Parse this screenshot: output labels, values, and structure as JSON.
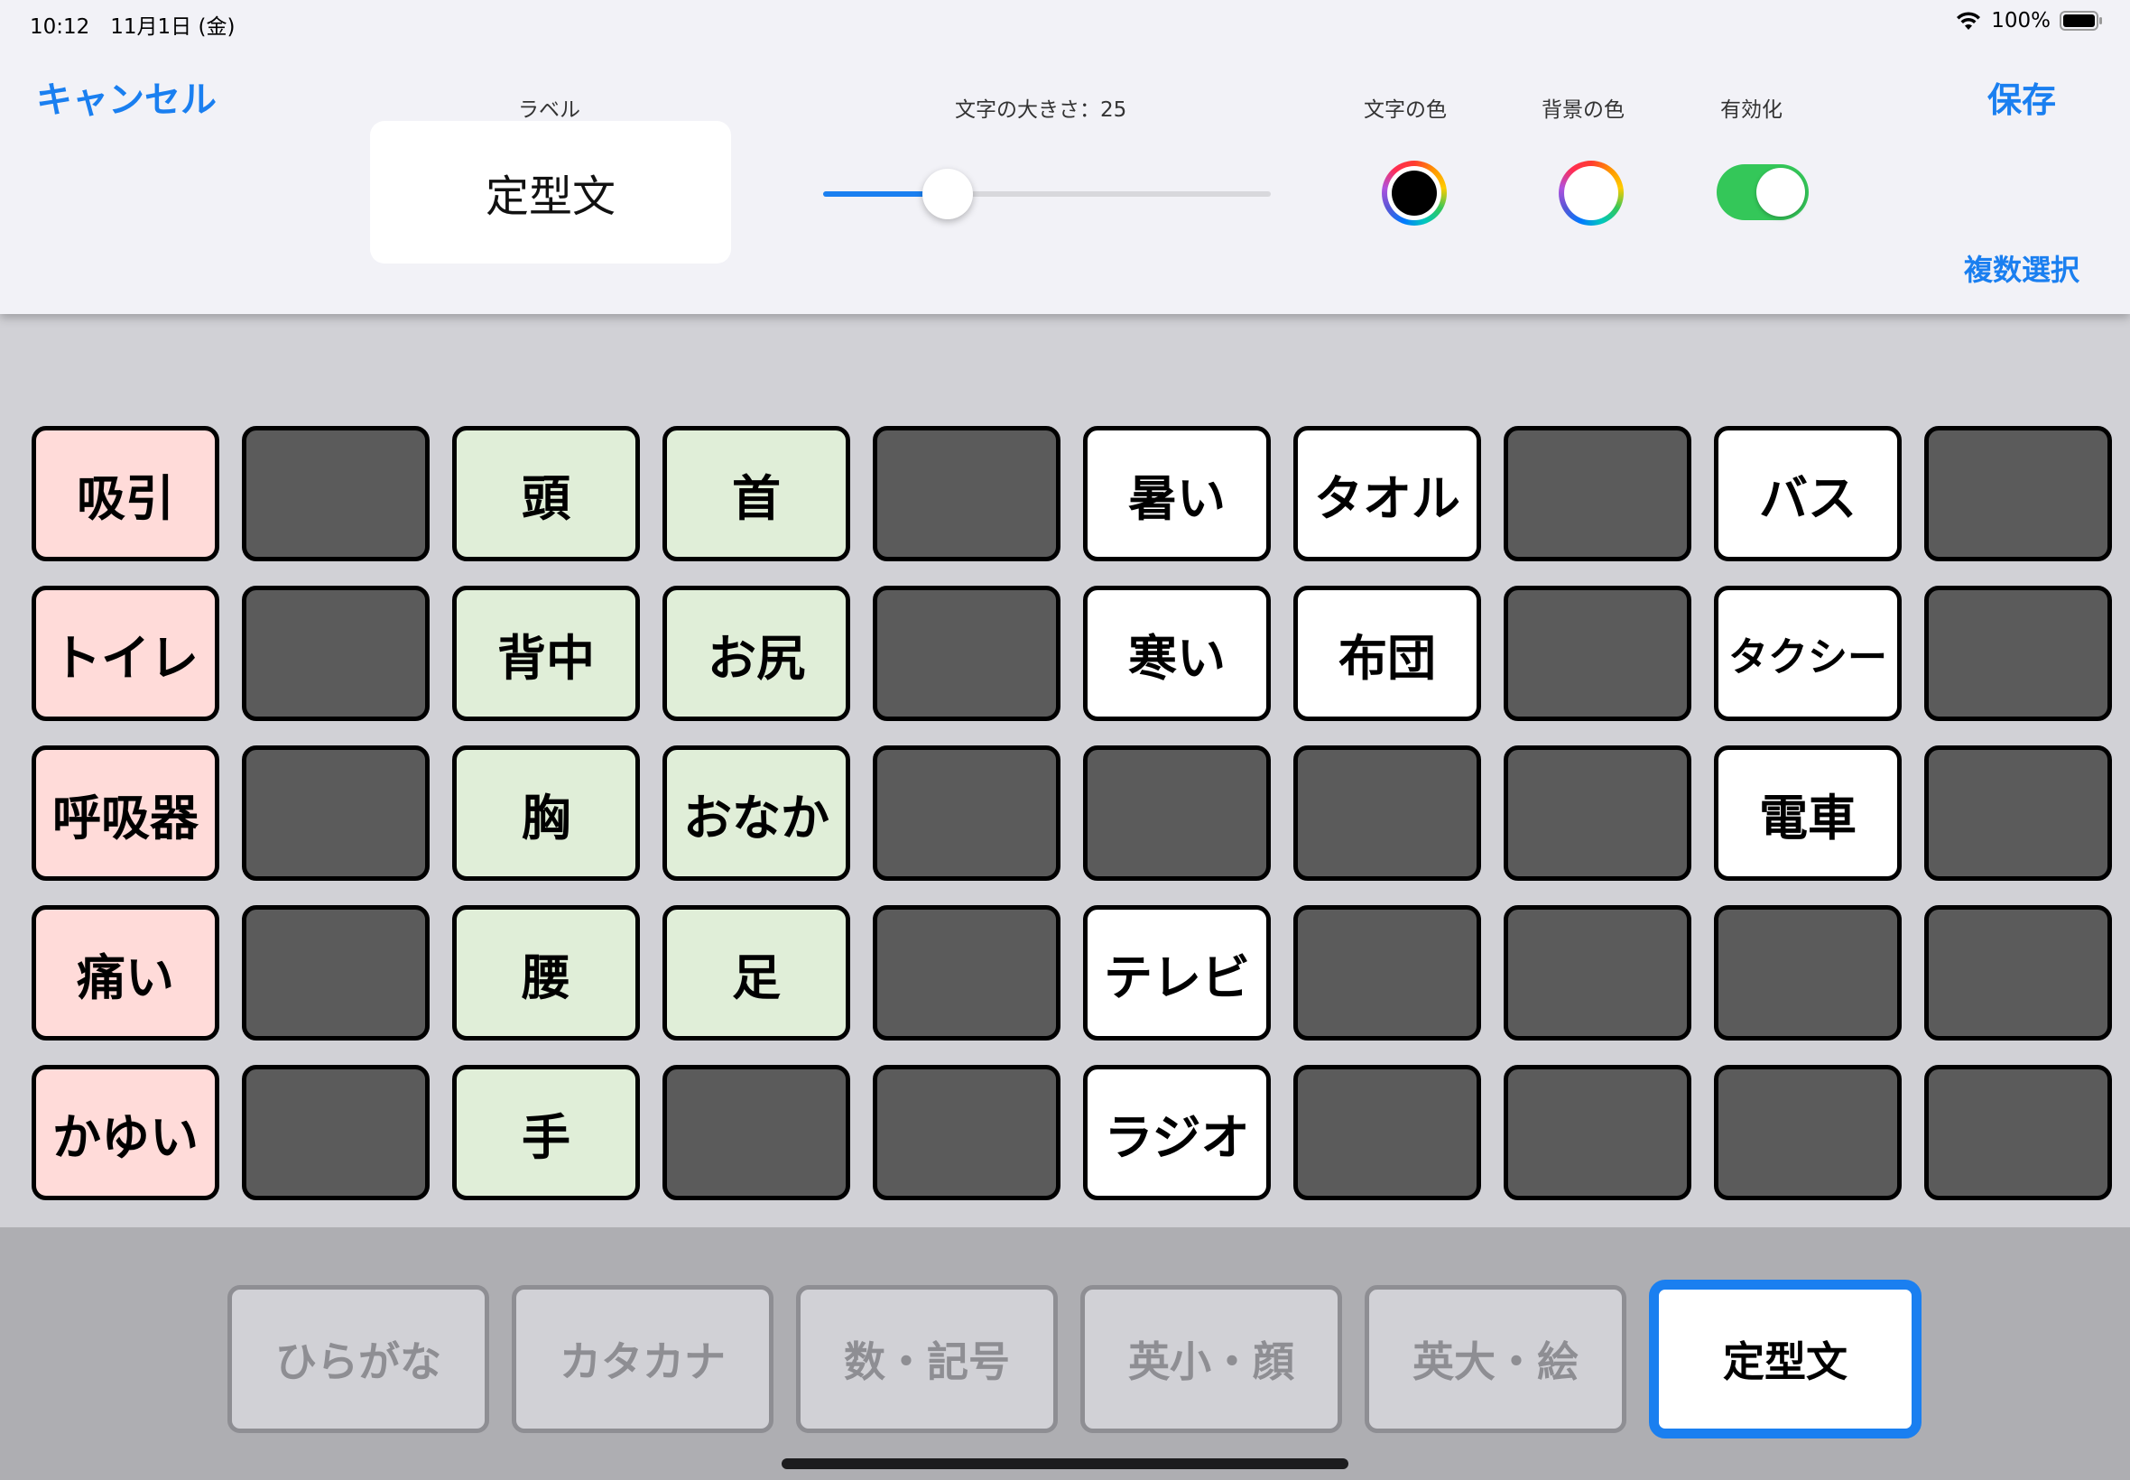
{
  "status_bar": {
    "time": "10:12　11月1日 (金)",
    "battery": "100%",
    "icons": [
      "wifi-icon",
      "battery-icon"
    ]
  },
  "toolbar": {
    "cancel_label": "キャンセル",
    "save_label": "保存",
    "multi_select_label": "複数選択",
    "label_caption": "ラベル",
    "label_value": "定型文",
    "font_size_caption": "文字の大きさ：25",
    "font_size_value": 25,
    "text_color_caption": "文字の色",
    "text_color": "#000000",
    "bg_color_caption": "背景の色",
    "bg_color": "#ffffff",
    "enabled_caption": "有効化",
    "enabled": true
  },
  "colors": {
    "accent": "#1a7ff0",
    "toggle_on": "#34c759",
    "pink": "#ffdbd9",
    "green": "#e0eed8",
    "white": "#ffffff",
    "empty": "#5b5b5b"
  },
  "grid": {
    "rows": [
      [
        {
          "label": "吸引",
          "color": "pink"
        },
        {
          "label": "",
          "color": "empty"
        },
        {
          "label": "頭",
          "color": "green"
        },
        {
          "label": "首",
          "color": "green"
        },
        {
          "label": "",
          "color": "empty"
        },
        {
          "label": "暑い",
          "color": "white"
        },
        {
          "label": "タオル",
          "color": "white"
        },
        {
          "label": "",
          "color": "empty"
        },
        {
          "label": "バス",
          "color": "white"
        },
        {
          "label": "",
          "color": "empty"
        }
      ],
      [
        {
          "label": "トイレ",
          "color": "pink"
        },
        {
          "label": "",
          "color": "empty"
        },
        {
          "label": "背中",
          "color": "green"
        },
        {
          "label": "お尻",
          "color": "green"
        },
        {
          "label": "",
          "color": "empty"
        },
        {
          "label": "寒い",
          "color": "white"
        },
        {
          "label": "布団",
          "color": "white"
        },
        {
          "label": "",
          "color": "empty"
        },
        {
          "label": "タクシー",
          "color": "white"
        },
        {
          "label": "",
          "color": "empty"
        }
      ],
      [
        {
          "label": "呼吸器",
          "color": "pink"
        },
        {
          "label": "",
          "color": "empty"
        },
        {
          "label": "胸",
          "color": "green"
        },
        {
          "label": "おなか",
          "color": "green"
        },
        {
          "label": "",
          "color": "empty"
        },
        {
          "label": "",
          "color": "empty"
        },
        {
          "label": "",
          "color": "empty"
        },
        {
          "label": "",
          "color": "empty"
        },
        {
          "label": "電車",
          "color": "white"
        },
        {
          "label": "",
          "color": "empty"
        }
      ],
      [
        {
          "label": "痛い",
          "color": "pink"
        },
        {
          "label": "",
          "color": "empty"
        },
        {
          "label": "腰",
          "color": "green"
        },
        {
          "label": "足",
          "color": "green"
        },
        {
          "label": "",
          "color": "empty"
        },
        {
          "label": "テレビ",
          "color": "white"
        },
        {
          "label": "",
          "color": "empty"
        },
        {
          "label": "",
          "color": "empty"
        },
        {
          "label": "",
          "color": "empty"
        },
        {
          "label": "",
          "color": "empty"
        }
      ],
      [
        {
          "label": "かゆい",
          "color": "pink"
        },
        {
          "label": "",
          "color": "empty"
        },
        {
          "label": "手",
          "color": "green"
        },
        {
          "label": "",
          "color": "empty"
        },
        {
          "label": "",
          "color": "empty"
        },
        {
          "label": "ラジオ",
          "color": "white"
        },
        {
          "label": "",
          "color": "empty"
        },
        {
          "label": "",
          "color": "empty"
        },
        {
          "label": "",
          "color": "empty"
        },
        {
          "label": "",
          "color": "empty"
        }
      ]
    ]
  },
  "tabs": [
    {
      "label": "ひらがな",
      "active": false
    },
    {
      "label": "カタカナ",
      "active": false
    },
    {
      "label": "数・記号",
      "active": false
    },
    {
      "label": "英小・顔",
      "active": false
    },
    {
      "label": "英大・絵",
      "active": false
    },
    {
      "label": "定型文",
      "active": true
    }
  ]
}
